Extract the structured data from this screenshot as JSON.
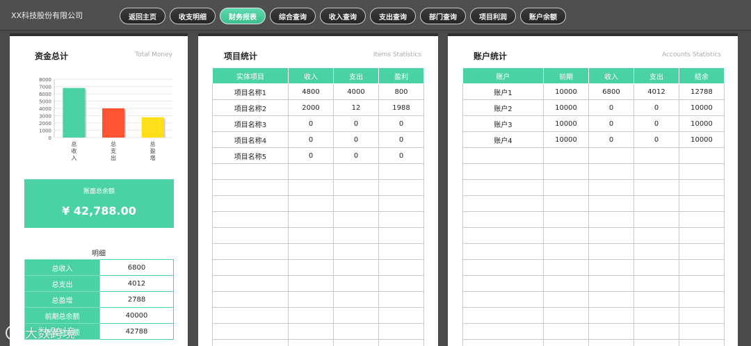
{
  "header": {
    "brand": "XX科技股份有限公司",
    "nav": [
      {
        "label": "返回主页",
        "name": "nav-home"
      },
      {
        "label": "收支明细",
        "name": "nav-income-expense-detail"
      },
      {
        "label": "财务报表",
        "name": "nav-financial-report",
        "active": true
      },
      {
        "label": "综合查询",
        "name": "nav-general-query"
      },
      {
        "label": "收入查询",
        "name": "nav-income-query"
      },
      {
        "label": "支出查询",
        "name": "nav-expense-query"
      },
      {
        "label": "部门查询",
        "name": "nav-department-query"
      },
      {
        "label": "项目利润",
        "name": "nav-project-profit"
      },
      {
        "label": "账户余额",
        "name": "nav-account-balance"
      }
    ]
  },
  "funds": {
    "title": "资金总计",
    "subtitle": "Total Money",
    "total_label": "账面总余额",
    "total_amount": "¥ 42,788.00",
    "detail_title": "明细",
    "detail_rows": [
      {
        "k": "总收入",
        "v": "6800"
      },
      {
        "k": "总支出",
        "v": "4012"
      },
      {
        "k": "总盈增",
        "v": "2788"
      },
      {
        "k": "前期总余额",
        "v": "40000"
      },
      {
        "k": "账面总余额",
        "v": "42788"
      }
    ]
  },
  "chart_data": {
    "type": "bar",
    "categories": [
      "总收入",
      "总支出",
      "总盈增"
    ],
    "values": [
      6800,
      4012,
      2788
    ],
    "ylim": [
      0,
      8000
    ],
    "yticks": [
      0,
      1000,
      2000,
      3000,
      4000,
      5000,
      6000,
      7000,
      8000
    ],
    "bar_colors": [
      "#4bd1a6",
      "#ff5533",
      "#ffde1a"
    ],
    "grid": true
  },
  "items": {
    "title": "项目统计",
    "subtitle": "Items Statistics",
    "columns": [
      "实体项目",
      "收入",
      "支出",
      "盈利"
    ],
    "rows": [
      [
        "项目名称1",
        "4800",
        "4000",
        "800"
      ],
      [
        "项目名称2",
        "2000",
        "12",
        "1988"
      ],
      [
        "项目名称3",
        "0",
        "0",
        "0"
      ],
      [
        "项目名称4",
        "0",
        "0",
        "0"
      ],
      [
        "项目名称5",
        "0",
        "0",
        "0"
      ]
    ]
  },
  "accounts": {
    "title": "账户统计",
    "subtitle": "Accounts Statistics",
    "columns": [
      "账户",
      "前期",
      "收入",
      "支出",
      "结余"
    ],
    "rows": [
      [
        "账户1",
        "10000",
        "6800",
        "4012",
        "12788"
      ],
      [
        "账户2",
        "10000",
        "0",
        "0",
        "10000"
      ],
      [
        "账户3",
        "10000",
        "0",
        "0",
        "10000"
      ],
      [
        "账户4",
        "10000",
        "0",
        "0",
        "10000"
      ]
    ]
  },
  "watermark": "大数跨境"
}
